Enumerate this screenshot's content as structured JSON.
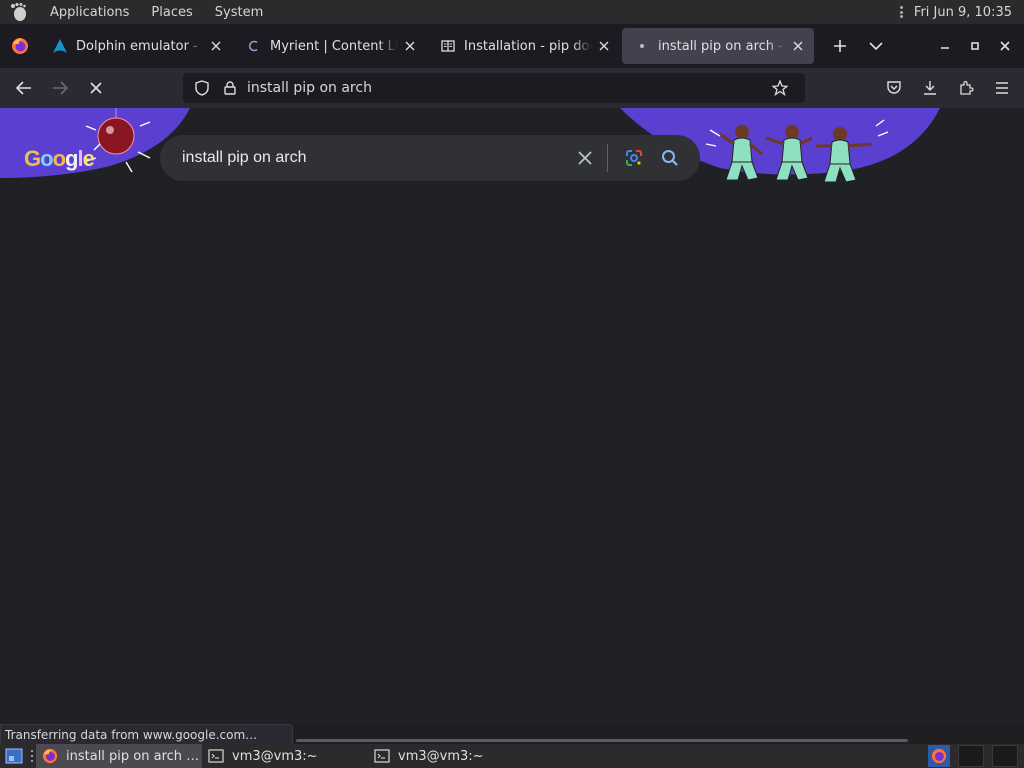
{
  "top_panel": {
    "menus": [
      "Applications",
      "Places",
      "System"
    ],
    "clock": "Fri Jun  9, 10:35"
  },
  "tabs": [
    {
      "title": "Dolphin emulator - ArchWiki",
      "icon": "arch-icon",
      "active": false
    },
    {
      "title": "Myrient | Content Listing",
      "icon": "myrient-icon",
      "active": false
    },
    {
      "title": "Installation - pip documentation",
      "icon": "book-icon",
      "active": false
    },
    {
      "title": "install pip on arch - Google Search",
      "icon": "loading-dot-icon",
      "active": true
    }
  ],
  "nav": {
    "url_text": "install pip on arch"
  },
  "google": {
    "logo_text": "Google",
    "search_query": "install pip on arch"
  },
  "status": {
    "text": "Transferring data from www.google.com…"
  },
  "taskbar": {
    "tasks": [
      {
        "label": "install pip on arch …",
        "icon": "firefox-icon",
        "active": true
      },
      {
        "label": "vm3@vm3:~",
        "icon": "terminal-icon",
        "active": false
      },
      {
        "label": "vm3@vm3:~",
        "icon": "terminal-icon",
        "active": false
      }
    ]
  },
  "colors": {
    "doodle_purple": "#5b3fd0",
    "search_bg": "#303134",
    "page_bg": "#202124",
    "tab_active_bg": "#42414d"
  }
}
